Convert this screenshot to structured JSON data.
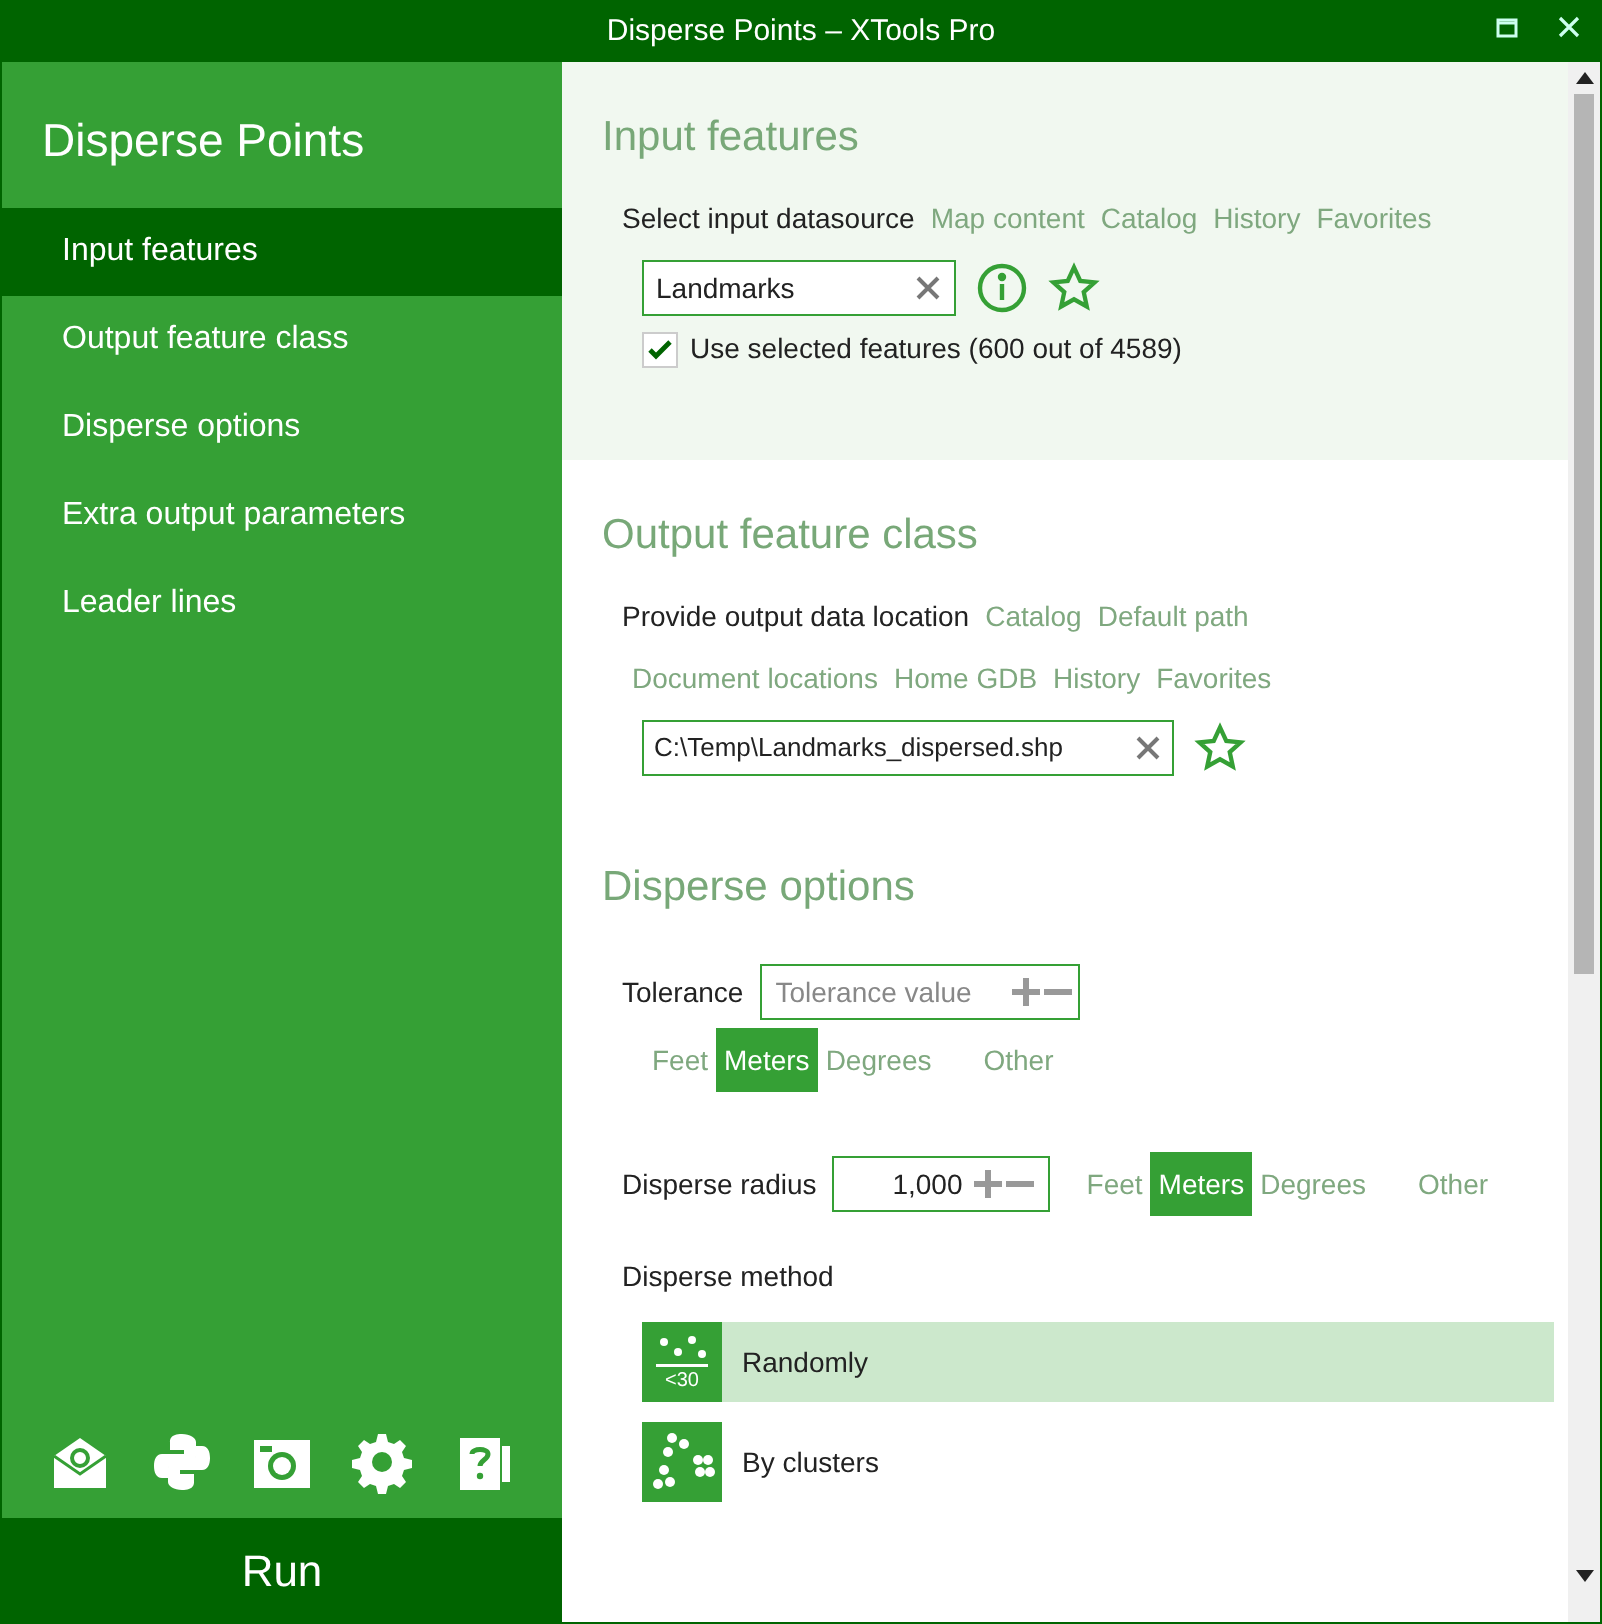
{
  "window": {
    "title": "Disperse Points – XTools Pro"
  },
  "sidebar": {
    "title": "Disperse Points",
    "items": [
      {
        "label": "Input features",
        "selected": true
      },
      {
        "label": "Output feature class",
        "selected": false
      },
      {
        "label": "Disperse options",
        "selected": false
      },
      {
        "label": "Extra output parameters",
        "selected": false
      },
      {
        "label": "Leader lines",
        "selected": false
      }
    ],
    "run_button": "Run"
  },
  "input_features": {
    "title": "Input features",
    "label": "Select input datasource",
    "links": [
      "Map content",
      "Catalog",
      "History",
      "Favorites"
    ],
    "value": "Landmarks",
    "use_selected": {
      "label": "Use selected features (600 out of 4589)",
      "checked": true
    }
  },
  "output_feature_class": {
    "title": "Output feature class",
    "label": "Provide output data location",
    "links": [
      "Catalog",
      "Default path",
      "Document locations",
      "Home GDB",
      "History",
      "Favorites"
    ],
    "value": "C:\\Temp\\Landmarks_dispersed.shp"
  },
  "disperse_options": {
    "title": "Disperse options",
    "tolerance": {
      "label": "Tolerance",
      "placeholder": "Tolerance value",
      "units": [
        {
          "label": "Feet",
          "selected": false
        },
        {
          "label": "Meters",
          "selected": true
        },
        {
          "label": "Degrees",
          "selected": false
        },
        {
          "label": "Other",
          "selected": false
        }
      ]
    },
    "radius": {
      "label": "Disperse radius",
      "value": "1,000",
      "units": [
        {
          "label": "Feet",
          "selected": false
        },
        {
          "label": "Meters",
          "selected": true
        },
        {
          "label": "Degrees",
          "selected": false
        },
        {
          "label": "Other",
          "selected": false
        }
      ]
    },
    "method_label": "Disperse method",
    "methods": [
      {
        "label": "Randomly",
        "kind": "random",
        "icon_text": "<30",
        "selected": true
      },
      {
        "label": "By clusters",
        "kind": "clusters",
        "selected": false
      }
    ]
  }
}
